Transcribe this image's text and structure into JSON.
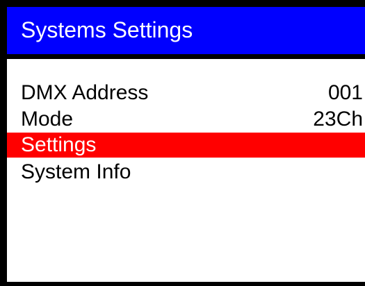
{
  "title": "Systems Settings",
  "menu": {
    "items": [
      {
        "label": "DMX Address",
        "value": "001",
        "selected": false
      },
      {
        "label": "Mode",
        "value": "23Ch",
        "selected": false
      },
      {
        "label": "Settings",
        "value": "",
        "selected": true
      },
      {
        "label": "System Info",
        "value": "",
        "selected": false
      }
    ]
  },
  "colors": {
    "title_bar": "#0000ff",
    "title_text": "#ffffff",
    "selection": "#ff0000",
    "frame": "#000000",
    "background": "#ffffff"
  }
}
